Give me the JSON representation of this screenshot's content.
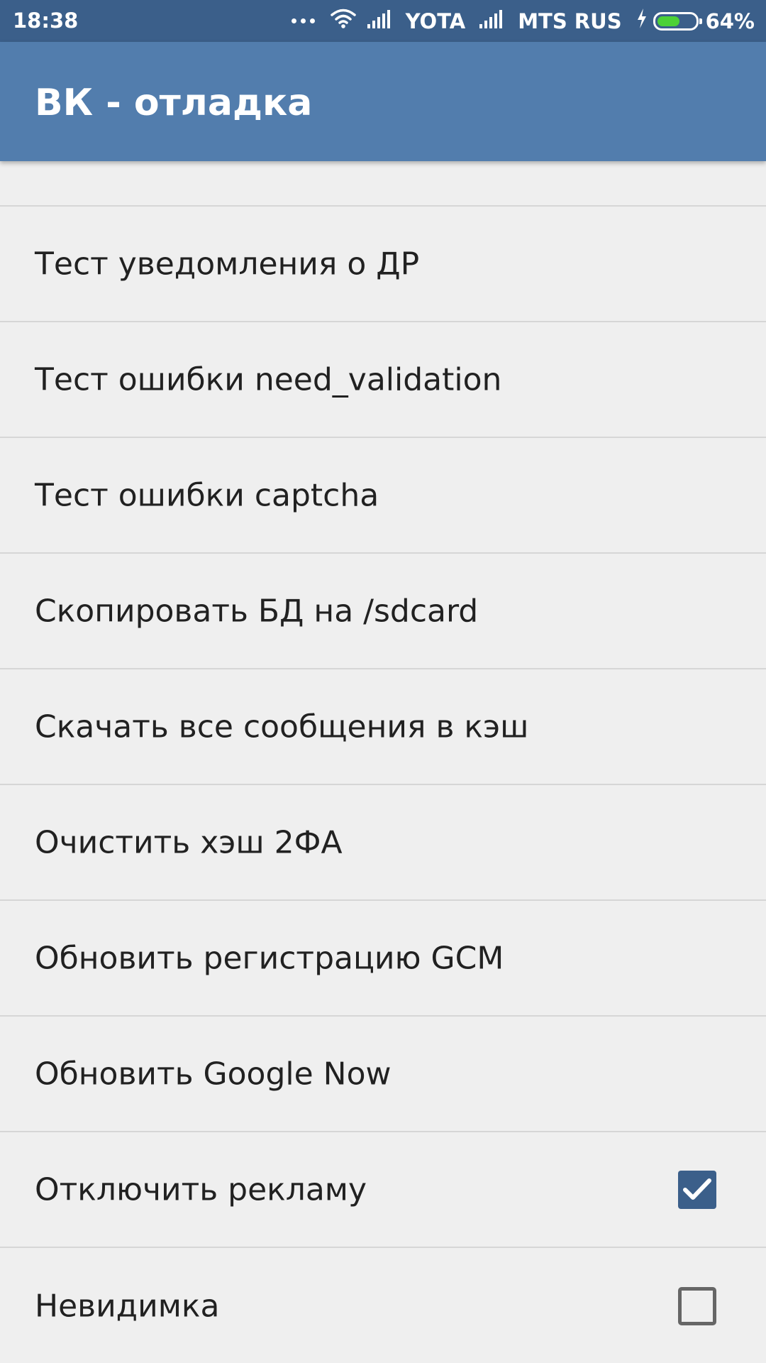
{
  "status_bar": {
    "time": "18:38",
    "carrier_1": "YOTA",
    "carrier_2": "MTS RUS",
    "battery_percent": "64%",
    "battery_level": 0.64,
    "icons": [
      "more-dots-icon",
      "wifi-icon",
      "signal-icon",
      "charging-bolt-icon",
      "battery-icon"
    ]
  },
  "app_bar": {
    "title": "ВК - отладка"
  },
  "list": {
    "items": [
      {
        "label": "Тест уведомления о ДР"
      },
      {
        "label": "Тест ошибки need_validation"
      },
      {
        "label": "Тест ошибки captcha"
      },
      {
        "label": "Скопировать БД на /sdcard"
      },
      {
        "label": "Скачать все сообщения в кэш"
      },
      {
        "label": "Очистить хэш 2ФА"
      },
      {
        "label": "Обновить регистрацию GCM"
      },
      {
        "label": "Обновить Google Now"
      },
      {
        "label": "Отключить рекламу",
        "checked": true
      },
      {
        "label": "Невидимка",
        "checked": false
      }
    ]
  },
  "colors": {
    "status_bar_bg": "#3b5f8a",
    "app_bar_bg": "#527dad",
    "list_bg": "#efefef",
    "checkbox_checked": "#3b5f8a",
    "battery_fill": "#4cd137"
  }
}
